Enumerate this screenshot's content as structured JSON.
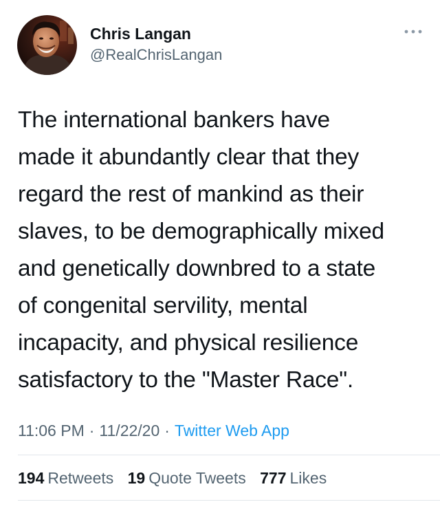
{
  "author": {
    "name": "Chris Langan",
    "handle": "@RealChrisLangan"
  },
  "tweet": {
    "text": "The international bankers have\nmade it abundantly clear that they\nregard the rest of mankind as their\nslaves, to be demographically mixed\nand genetically downbred to a state\nof congenital servility, mental\nincapacity, and physical resilience\nsatisfactory to the \"Master Race\"."
  },
  "meta": {
    "time": "11:06 PM",
    "date": "11/22/20",
    "separator": "·",
    "app": "Twitter Web App"
  },
  "stats": {
    "retweets_count": "194",
    "retweets_label": "Retweets",
    "quote_tweets_count": "19",
    "quote_tweets_label": "Quote Tweets",
    "likes_count": "777",
    "likes_label": "Likes"
  },
  "colors": {
    "link": "#1d9bf0",
    "secondary_text": "#536471",
    "primary_text": "#0f1419",
    "divider": "#e1e6ea"
  },
  "icons": {
    "more": "more-horizontal-icon"
  }
}
